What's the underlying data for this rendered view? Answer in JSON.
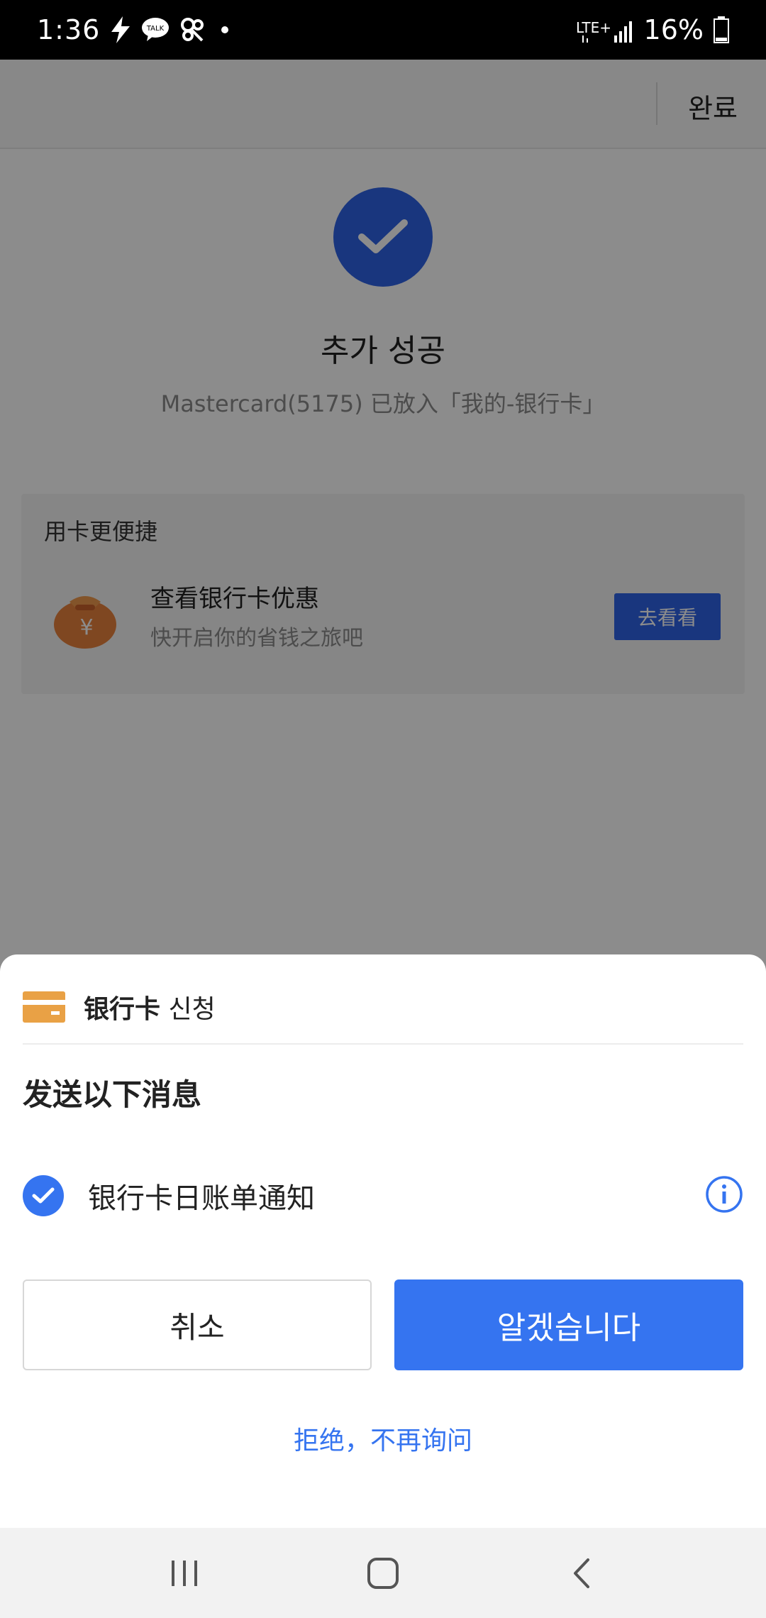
{
  "status_bar": {
    "time": "1:36",
    "network": "LTE+",
    "battery": "16%",
    "icons": [
      "flash-icon",
      "kakaotalk-icon",
      "pinwheel-icon",
      "dot-icon",
      "signal-icon",
      "battery-icon"
    ]
  },
  "background_page": {
    "done_label": "완료",
    "success_title": "추가 성공",
    "success_subtitle": "Mastercard(5175) 已放入「我的-银行卡」",
    "promo": {
      "header": "用卡更便捷",
      "title": "查看银行卡优惠",
      "description": "快开启你的省钱之旅吧",
      "button_label": "去看看"
    }
  },
  "sheet": {
    "app_name": "银行卡",
    "request_label": "신청",
    "title": "发送以下消息",
    "permission": {
      "label": "银行卡日账单通知",
      "checked": true
    },
    "cancel_label": "취소",
    "ok_label": "알겠습니다",
    "reject_label": "拒绝，不再询问"
  },
  "colors": {
    "accent": "#3574f0",
    "success": "#2f63e6",
    "card_icon": "#e9a145"
  },
  "nav_bar": {
    "icons": [
      "recents-icon",
      "home-icon",
      "back-icon"
    ]
  }
}
